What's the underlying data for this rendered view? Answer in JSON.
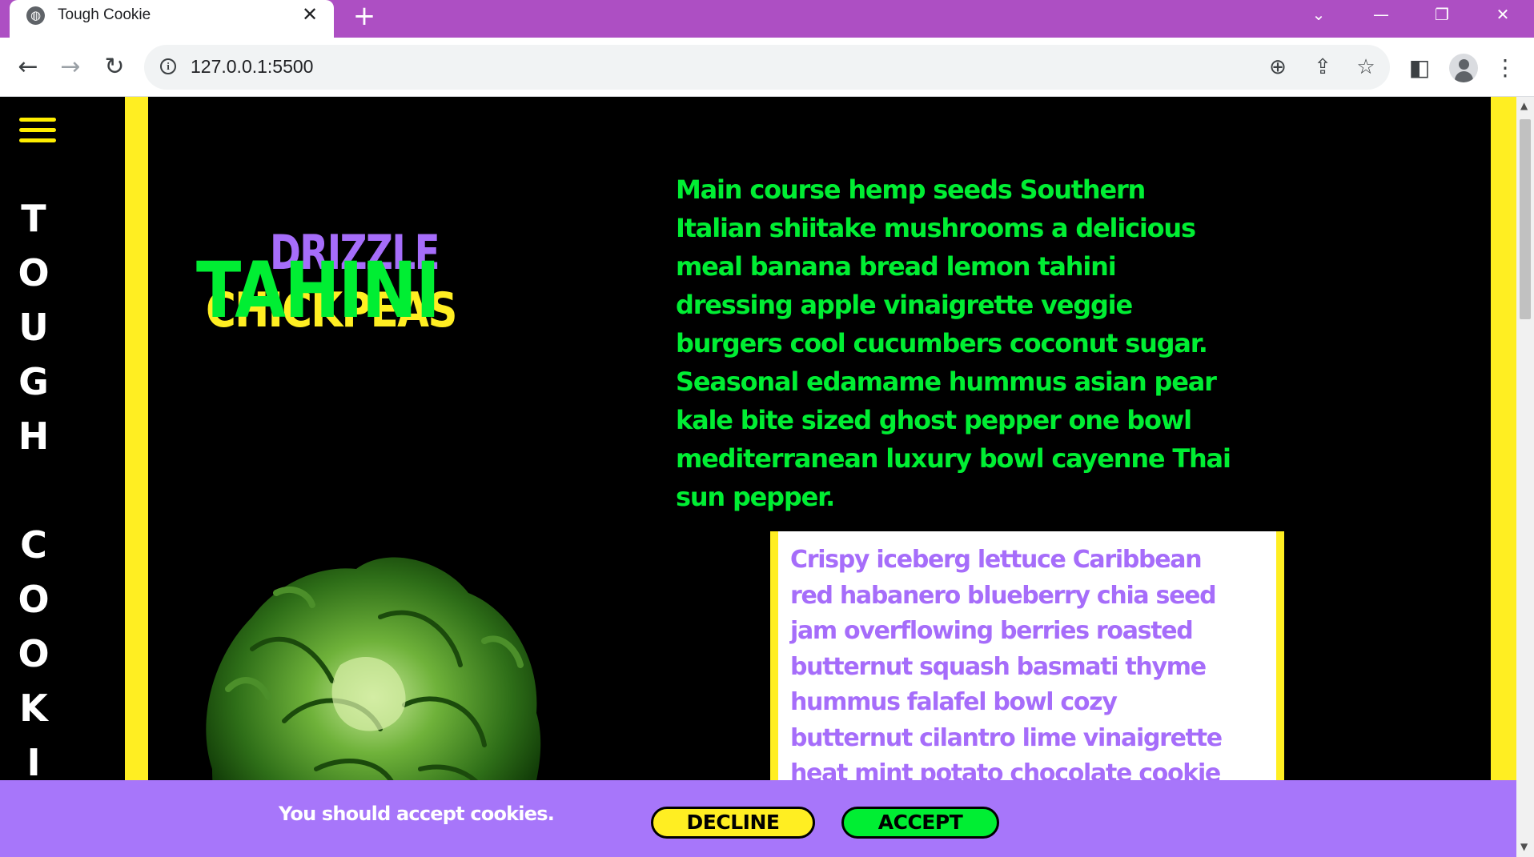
{
  "browser": {
    "tab_title": "Tough Cookie",
    "close_glyph": "✕",
    "new_tab_glyph": "+",
    "url": "127.0.0.1:5500",
    "icons": [
      "globe-icon",
      "close-icon",
      "plus-icon",
      "chevron-down-icon",
      "minimize-icon",
      "restore-icon",
      "window-close-icon",
      "back-icon",
      "forward-icon",
      "reload-icon",
      "info-icon",
      "zoom-icon",
      "share-icon",
      "star-icon",
      "side-panel-icon",
      "profile-icon",
      "menu-icon"
    ]
  },
  "sidebar": {
    "letters": [
      "T",
      "O",
      "U",
      "G",
      "H",
      "",
      "C",
      "O",
      "O",
      "K",
      "I"
    ],
    "accent_color": "#ffee22"
  },
  "hero": {
    "word_top": "DRIZZLE",
    "word_main": "TAHINI",
    "word_bottom": "CHICKPEAS"
  },
  "main_paragraph": "Main course hemp seeds Southern Italian shiitake mushrooms a delicious meal banana bread lemon tahini dressing apple vinaigrette veggie burgers cool cucumbers coconut sugar. Seasonal edamame hummus asian pear kale bite sized ghost pepper one bowl mediterranean luxury bowl cayenne Thai sun pepper.",
  "card_paragraph": "Crispy iceberg lettuce Caribbean red habanero blueberry chia seed jam overflowing berries roasted butternut squash basmati thyme hummus falafel bowl cozy butternut cilantro lime vinaigrette heat mint potato chocolate cookie seeds samosa walnut mushroom",
  "cookie_banner": {
    "message": "You should accept cookies.",
    "decline_label": "DECLINE",
    "accept_label": "ACCEPT"
  },
  "colors": {
    "green": "#00ee33",
    "purple": "#a66dfa",
    "yellow": "#ffee22",
    "tab_bar": "#ad4fc3"
  }
}
